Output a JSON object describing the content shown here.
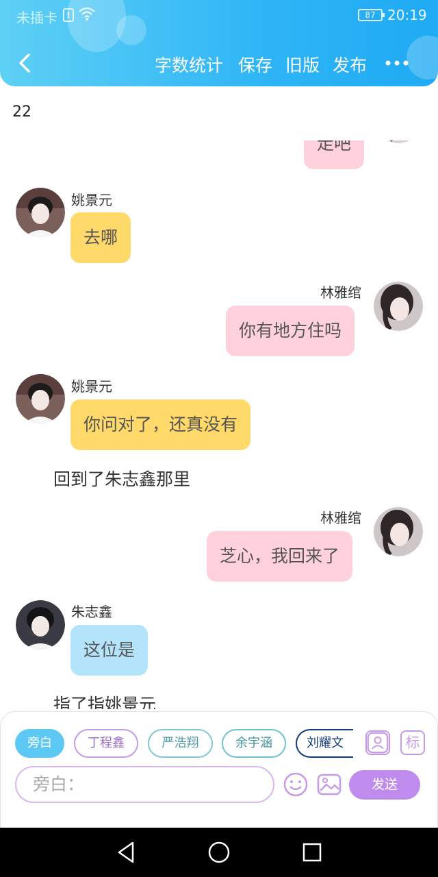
{
  "status_bar": {
    "carrier": "未插卡",
    "sim_alert": "!",
    "battery": "87",
    "time": "20:19"
  },
  "toolbar": {
    "word_count_label": "字数统计",
    "save_label": "保存",
    "old_version_label": "旧版",
    "publish_label": "发布"
  },
  "word_count": "22",
  "messages": [
    {
      "side": "right",
      "text": "走吧"
    },
    {
      "side": "left",
      "name": "姚景元",
      "text": "去哪"
    },
    {
      "side": "right",
      "name": "林雅绾",
      "text": "你有地方住吗"
    },
    {
      "side": "left",
      "name": "姚景元",
      "text": "你问对了，还真没有"
    },
    {
      "type": "narration",
      "text": "回到了朱志鑫那里"
    },
    {
      "side": "right",
      "name": "林雅绾",
      "text": "芝心，我回来了"
    },
    {
      "side": "left",
      "name": "朱志鑫",
      "text": "这位是"
    },
    {
      "type": "narration",
      "text": "指了指姚景元"
    }
  ],
  "characters": [
    "旁白",
    "丁程鑫",
    "严浩翔",
    "余宇涵",
    "刘耀文"
  ],
  "colors": {
    "header_start": "#5ed0f5",
    "header_end": "#1faaf4",
    "yellow_bubble": "#ffd96a",
    "pink_bubble": "#ffd1dc",
    "blue_bubble": "#b3e4fb",
    "send_button": "#bf8bed"
  },
  "input": {
    "placeholder": "旁白："
  },
  "send_label": "发送",
  "mark_label": "标"
}
